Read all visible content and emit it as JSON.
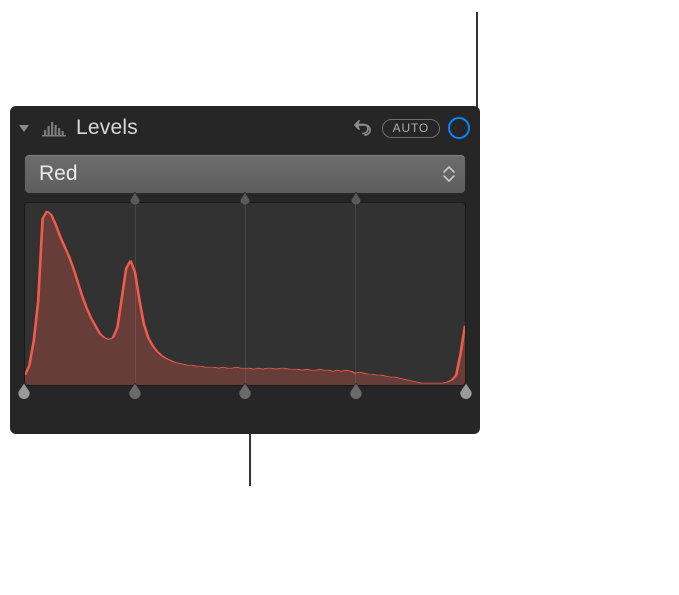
{
  "panel": {
    "title": "Levels",
    "auto_label": "AUTO"
  },
  "channel_popup": {
    "selected": "Red"
  },
  "colors": {
    "accent": "#0a84ff",
    "histogram_stroke": "#f25b4a",
    "histogram_fill": "rgba(242,91,74,0.28)"
  },
  "histogram": {
    "grid_positions_pct": [
      25,
      50,
      75
    ],
    "points": [
      [
        0,
        10
      ],
      [
        1,
        20
      ],
      [
        2,
        45
      ],
      [
        3,
        85
      ],
      [
        4,
        168
      ],
      [
        5,
        176
      ],
      [
        6,
        172
      ],
      [
        7,
        162
      ],
      [
        8,
        150
      ],
      [
        9,
        140
      ],
      [
        10,
        130
      ],
      [
        11,
        118
      ],
      [
        12,
        104
      ],
      [
        13,
        90
      ],
      [
        14,
        78
      ],
      [
        15,
        68
      ],
      [
        16,
        60
      ],
      [
        17,
        52
      ],
      [
        18,
        48
      ],
      [
        19,
        46
      ],
      [
        20,
        48
      ],
      [
        21,
        58
      ],
      [
        22,
        88
      ],
      [
        23,
        118
      ],
      [
        24,
        126
      ],
      [
        25,
        114
      ],
      [
        26,
        86
      ],
      [
        27,
        62
      ],
      [
        28,
        48
      ],
      [
        29,
        40
      ],
      [
        30,
        34
      ],
      [
        31,
        30
      ],
      [
        32,
        27
      ],
      [
        33,
        25
      ],
      [
        34,
        23
      ],
      [
        35,
        22
      ],
      [
        36,
        21
      ],
      [
        37,
        20
      ],
      [
        38,
        20
      ],
      [
        39,
        19
      ],
      [
        40,
        19
      ],
      [
        41,
        18
      ],
      [
        42,
        18
      ],
      [
        43,
        18
      ],
      [
        44,
        17
      ],
      [
        45,
        18
      ],
      [
        46,
        17
      ],
      [
        47,
        17
      ],
      [
        48,
        18
      ],
      [
        49,
        17
      ],
      [
        50,
        17
      ],
      [
        51,
        17
      ],
      [
        52,
        16
      ],
      [
        53,
        17
      ],
      [
        54,
        16
      ],
      [
        55,
        17
      ],
      [
        56,
        17
      ],
      [
        57,
        16
      ],
      [
        58,
        17
      ],
      [
        59,
        17
      ],
      [
        60,
        16
      ],
      [
        61,
        16
      ],
      [
        62,
        16
      ],
      [
        63,
        15
      ],
      [
        64,
        16
      ],
      [
        65,
        15
      ],
      [
        66,
        15
      ],
      [
        67,
        16
      ],
      [
        68,
        15
      ],
      [
        69,
        15
      ],
      [
        70,
        14
      ],
      [
        71,
        15
      ],
      [
        72,
        14
      ],
      [
        73,
        15
      ],
      [
        74,
        14
      ],
      [
        75,
        12
      ],
      [
        76,
        13
      ],
      [
        77,
        12
      ],
      [
        78,
        11
      ],
      [
        79,
        11
      ],
      [
        80,
        10
      ],
      [
        81,
        10
      ],
      [
        82,
        9
      ],
      [
        83,
        8
      ],
      [
        84,
        8
      ],
      [
        85,
        7
      ],
      [
        86,
        6
      ],
      [
        87,
        5
      ],
      [
        88,
        4
      ],
      [
        89,
        3
      ],
      [
        90,
        2
      ],
      [
        91,
        2
      ],
      [
        92,
        2
      ],
      [
        93,
        2
      ],
      [
        94,
        2
      ],
      [
        95,
        2
      ],
      [
        96,
        3
      ],
      [
        97,
        5
      ],
      [
        98,
        10
      ],
      [
        99,
        32
      ],
      [
        100,
        60
      ]
    ]
  },
  "sliders": {
    "top_positions_pct": [
      25,
      50,
      75
    ],
    "bottom_positions_pct": [
      0,
      25,
      50,
      75,
      100
    ]
  }
}
